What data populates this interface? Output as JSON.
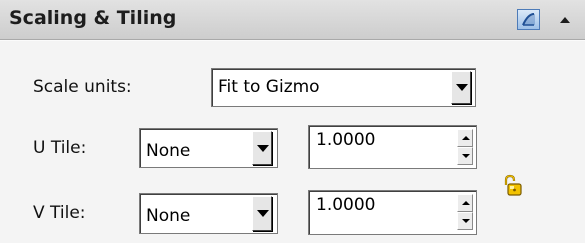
{
  "panel": {
    "title": "Scaling & Tiling"
  },
  "scale_units": {
    "label": "Scale units:",
    "value": "Fit to Gizmo"
  },
  "u_tile": {
    "label": "U Tile:",
    "mode": "None",
    "amount": "1.0000"
  },
  "v_tile": {
    "label": "V Tile:",
    "mode": "None",
    "amount": "1.0000"
  },
  "icons": {
    "header_icon": "uv-scale-icon",
    "collapse": "collapse-arrow-icon",
    "lock": "unlock-icon"
  },
  "colors": {
    "header_bg": "#d6d6d6",
    "panel_bg": "#f4f4f4",
    "accent_blue": "#4d7bb8",
    "lock_gold": "#e0a800"
  }
}
